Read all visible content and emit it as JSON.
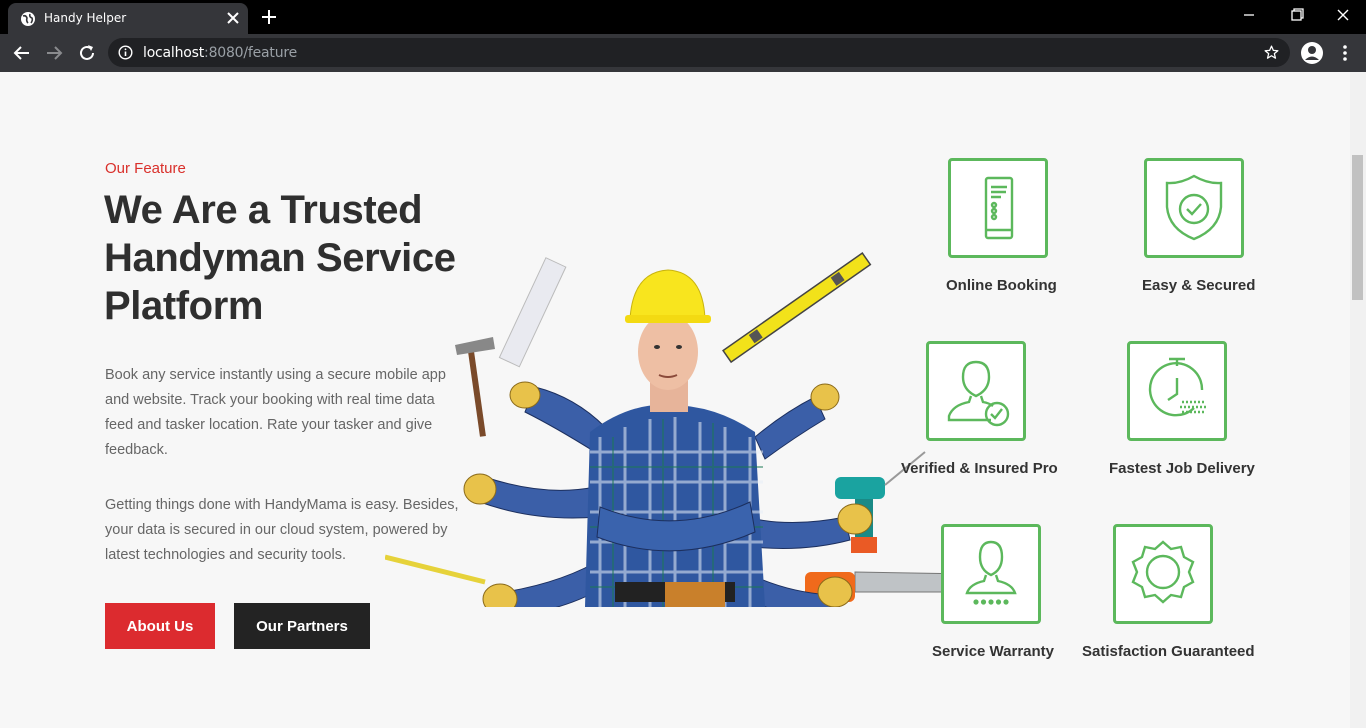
{
  "browser": {
    "tab_title": "Handy Helper",
    "url_host": "localhost",
    "url_rest": ":8080/feature"
  },
  "hero": {
    "eyebrow": "Our Feature",
    "headline": "We Are a Trusted Handyman Service Platform",
    "paragraph1": "Book any service instantly using a secure mobile app and website. Track your booking with real time data feed and tasker location. Rate your tasker and give feedback.",
    "paragraph2": "Getting things done with HandyMama is easy. Besides, your data is secured in our cloud system, powered by latest technologies and security tools.",
    "buttons": {
      "about": "About Us",
      "partners": "Our Partners"
    }
  },
  "features": [
    {
      "label": "Online Booking",
      "icon": "mobile-phone-icon"
    },
    {
      "label": "Easy & Secured",
      "icon": "shield-check-icon"
    },
    {
      "label": "Verified & Insured Pro",
      "icon": "user-check-icon"
    },
    {
      "label": "Fastest Job Delivery",
      "icon": "stopwatch-icon"
    },
    {
      "label": "Service Warranty",
      "icon": "user-stars-icon"
    },
    {
      "label": "Satisfaction Guaranteed",
      "icon": "badge-seal-icon"
    }
  ],
  "colors": {
    "accent_red": "#dc2b2f",
    "feature_green": "#5cb85c",
    "dark_button": "#232323"
  }
}
